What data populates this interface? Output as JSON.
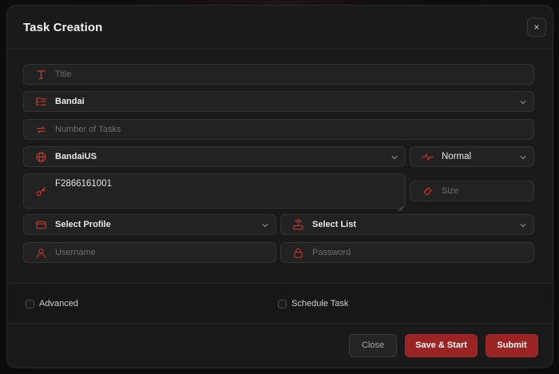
{
  "modal": {
    "title": "Task Creation",
    "close_x": "×"
  },
  "form": {
    "title_placeholder": "Title",
    "site_value": "Bandai",
    "task_count_placeholder": "Number of Tasks",
    "region_value": "BandaiUS",
    "mode_value": "Normal",
    "product_value": "F2866161001",
    "size_placeholder": "Size",
    "profile_value": "Select Profile",
    "list_value": "Select List",
    "username_placeholder": "Username",
    "password_placeholder": "Password"
  },
  "options": {
    "advanced_label": "Advanced",
    "schedule_label": "Schedule Task"
  },
  "footer": {
    "close_label": "Close",
    "save_start_label": "Save & Start",
    "submit_label": "Submit"
  },
  "colors": {
    "accent": "#c0392b",
    "button_primary": "#9a2424",
    "modal_bg": "#1a1a1a",
    "field_bg": "#222222"
  },
  "icons": {
    "title": "text-icon",
    "site": "list-tree-icon",
    "task_count": "repeat-icon",
    "region": "globe-icon",
    "mode": "activity-icon",
    "product": "key-icon",
    "size": "ruler-icon",
    "profile": "credit-card-icon",
    "list": "router-icon",
    "username": "user-icon",
    "password": "lock-icon",
    "chevron": "chevron-down-icon"
  }
}
